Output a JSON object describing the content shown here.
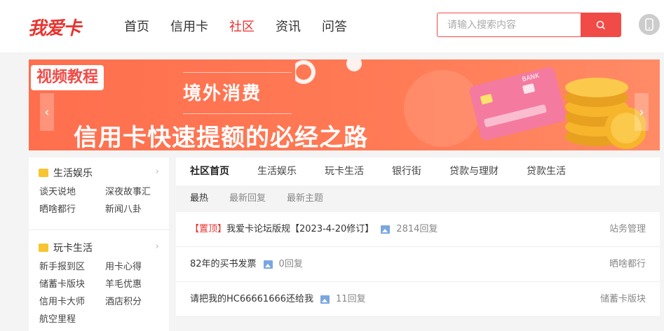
{
  "header": {
    "logo": "我爱卡",
    "nav": [
      {
        "label": "首页",
        "active": false
      },
      {
        "label": "信用卡",
        "active": false
      },
      {
        "label": "社区",
        "active": true
      },
      {
        "label": "资讯",
        "active": false
      },
      {
        "label": "问答",
        "active": false
      }
    ],
    "search": {
      "placeholder": "请输入搜索内容",
      "value": ""
    },
    "accent_color": "#f04b47"
  },
  "banner": {
    "tag": "视频教程",
    "subtitle": "境外消费",
    "title": "信用卡快速提额的必经之路",
    "card_text": "BANK"
  },
  "sidebar": {
    "categories": [
      {
        "name": "生活娱乐",
        "links": [
          "谈天说地",
          "深夜故事汇",
          "晒啥都行",
          "新闻八卦"
        ]
      },
      {
        "name": "玩卡生活",
        "links": [
          "新手报到区",
          "用卡心得",
          "储蓄卡版块",
          "羊毛优惠",
          "信用卡大师",
          "酒店积分",
          "航空里程"
        ]
      }
    ]
  },
  "main": {
    "tabs": [
      {
        "label": "社区首页",
        "active": true
      },
      {
        "label": "生活娱乐",
        "active": false
      },
      {
        "label": "玩卡生活",
        "active": false
      },
      {
        "label": "银行街",
        "active": false
      },
      {
        "label": "贷款与理财",
        "active": false
      },
      {
        "label": "贷款生活",
        "active": false
      }
    ],
    "subtabs": [
      {
        "label": "最热",
        "active": true
      },
      {
        "label": "最新回复",
        "active": false
      },
      {
        "label": "最新主题",
        "active": false
      }
    ],
    "posts": [
      {
        "pin": "【置顶】",
        "title": "我爱卡论坛版规【2023-4-20修订】",
        "replies": "2814回复",
        "forum": "站务管理"
      },
      {
        "pin": "",
        "title": "82年的买书发票",
        "replies": "0回复",
        "forum": "晒啥都行"
      },
      {
        "pin": "",
        "title": "请把我的HC66661666还给我",
        "replies": "11回复",
        "forum": "储蓄卡版块"
      }
    ]
  }
}
